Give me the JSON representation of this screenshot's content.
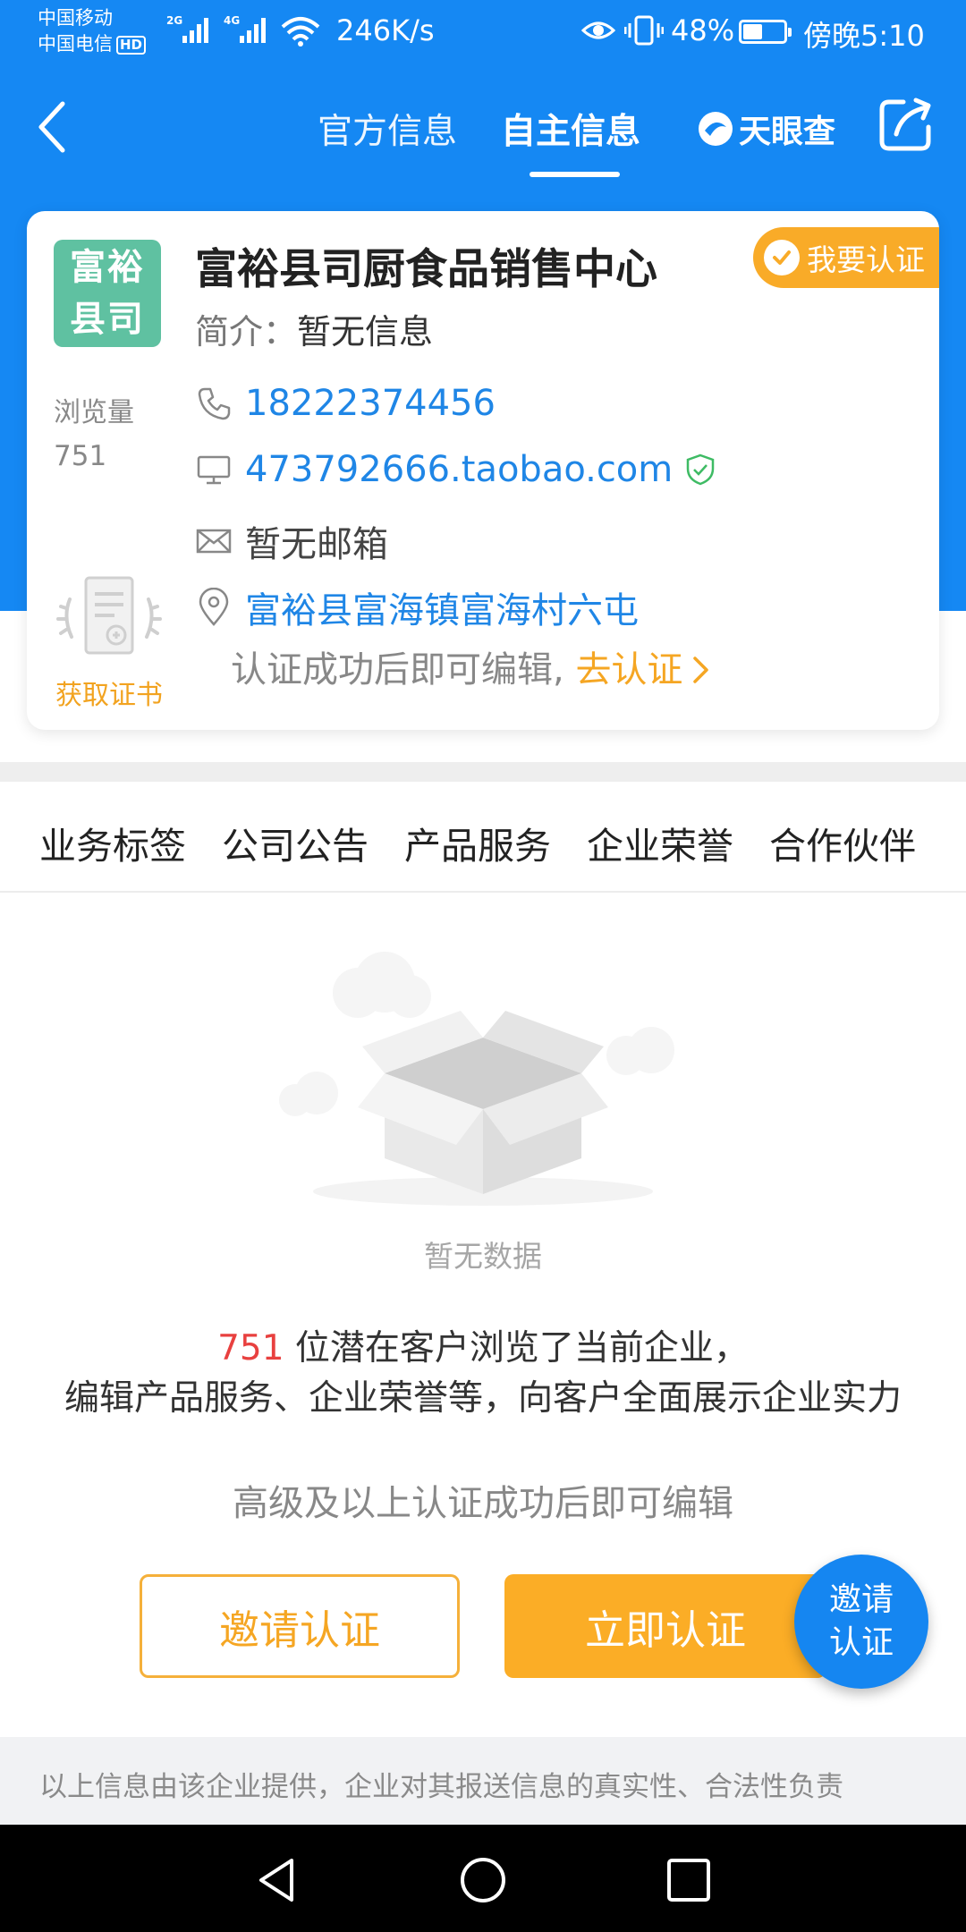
{
  "status_bar": {
    "carrier1": "中国移动",
    "carrier2": "中国电信",
    "hd": "HD",
    "net1": "2G",
    "net2": "4G",
    "speed": "246K/s",
    "battery": "48%",
    "battery_level": 0.48,
    "time": "傍晚5:10"
  },
  "nav": {
    "tab_official": "官方信息",
    "tab_self": "自主信息",
    "brand": "天眼查"
  },
  "company": {
    "logo_line1": "富裕",
    "logo_line2": "县司",
    "name": "富裕县司厨食品销售中心",
    "verify_badge": "我要认证",
    "intro_label": "简介：",
    "intro_value": "暂无信息",
    "views_label": "浏览量",
    "views_value": "751",
    "phone": "18222374456",
    "website": "473792666.taobao.com",
    "email": "暂无邮箱",
    "address": "富裕县富海镇富海村六屯",
    "certificate_label": "获取证书",
    "edit_note": "认证成功后即可编辑,",
    "edit_link": "去认证"
  },
  "sub_tabs": [
    "业务标签",
    "公司公告",
    "产品服务",
    "企业荣誉",
    "合作伙伴"
  ],
  "empty": {
    "text": "暂无数据"
  },
  "promo": {
    "count": "751",
    "line1_rest": " 位潜在客户浏览了当前企业，",
    "line2": "编辑产品服务、企业荣誉等，向客户全面展示企业实力",
    "advanced": "高级及以上认证成功后即可编辑"
  },
  "buttons": {
    "invite": "邀请认证",
    "verify_now": "立即认证",
    "fab_line1": "邀请",
    "fab_line2": "认证"
  },
  "footer": {
    "disclaimer": "以上信息由该企业提供，企业对其报送信息的真实性、合法性负责"
  },
  "colors": {
    "primary_blue": "#1588f3",
    "accent_orange": "#fbad26",
    "logo_green": "#5fc1a1",
    "highlight_red": "#e8403f"
  }
}
